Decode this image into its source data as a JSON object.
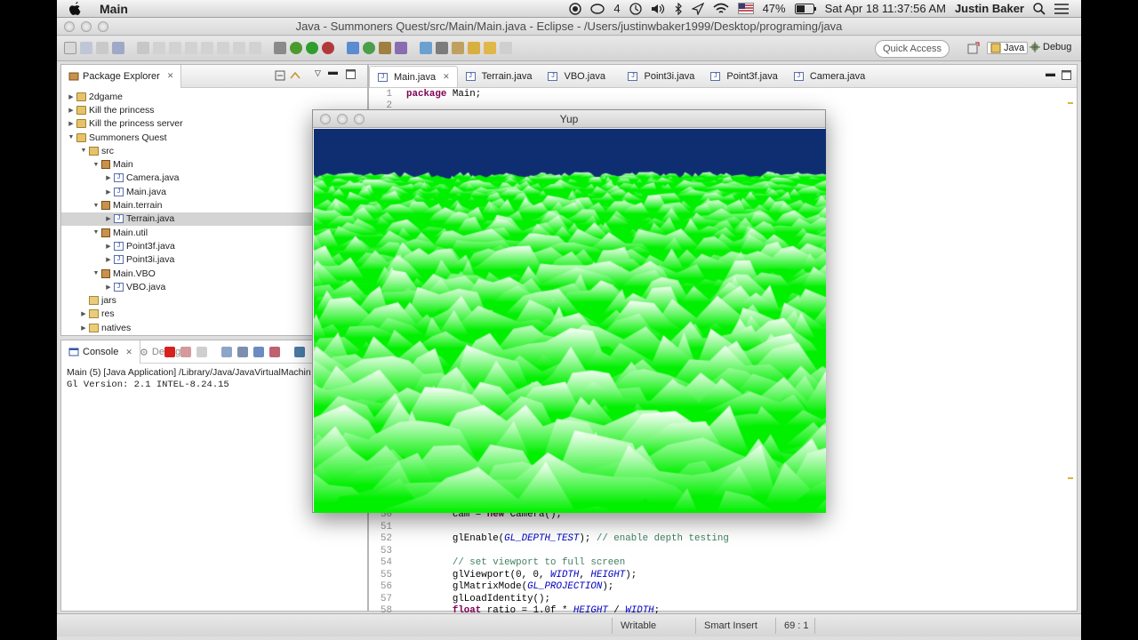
{
  "menubar": {
    "apple": "",
    "app": "Main",
    "wifi_count": "4",
    "battery": "47%",
    "datetime": "Sat Apr 18  11:37:56 AM",
    "user": "Justin Baker",
    "search_icon": "⌕",
    "list_icon": "☰"
  },
  "window_title": "Java - Summoners Quest/src/Main/Main.java - Eclipse - /Users/justinwbaker1999/Desktop/programing/java",
  "toolbar": {
    "quick_access": "Quick Access",
    "java_label": "Java",
    "debug_label": "Debug"
  },
  "package_explorer": {
    "title": "Package Explorer",
    "rows": [
      {
        "label": "2dgame",
        "arrow": "▶",
        "icon": "project",
        "indent": 0
      },
      {
        "label": "Kill the princess",
        "arrow": "▶",
        "icon": "project",
        "indent": 0
      },
      {
        "label": "Kill the princess server",
        "arrow": "▶",
        "icon": "project",
        "indent": 0
      },
      {
        "label": "Summoners Quest",
        "arrow": "▼",
        "icon": "project",
        "indent": 0
      },
      {
        "label": "src",
        "arrow": "▼",
        "icon": "src",
        "indent": 1
      },
      {
        "label": "Main",
        "arrow": "▼",
        "icon": "pkg",
        "indent": 2
      },
      {
        "label": "Camera.java",
        "arrow": "▶",
        "icon": "java",
        "indent": 3
      },
      {
        "label": "Main.java",
        "arrow": "▶",
        "icon": "java",
        "indent": 3
      },
      {
        "label": "Main.terrain",
        "arrow": "▼",
        "icon": "pkg",
        "indent": 2
      },
      {
        "label": "Terrain.java",
        "arrow": "▶",
        "icon": "java",
        "indent": 3,
        "selected": true
      },
      {
        "label": "Main.util",
        "arrow": "▼",
        "icon": "pkg",
        "indent": 2
      },
      {
        "label": "Point3f.java",
        "arrow": "▶",
        "icon": "java",
        "indent": 3
      },
      {
        "label": "Point3i.java",
        "arrow": "▶",
        "icon": "java",
        "indent": 3
      },
      {
        "label": "Main.VBO",
        "arrow": "▼",
        "icon": "pkg",
        "indent": 2
      },
      {
        "label": "VBO.java",
        "arrow": "▶",
        "icon": "java",
        "indent": 3
      },
      {
        "label": "jars",
        "arrow": "",
        "icon": "folder",
        "indent": 1
      },
      {
        "label": "res",
        "arrow": "▶",
        "icon": "folder",
        "indent": 1
      },
      {
        "label": "natives",
        "arrow": "▶",
        "icon": "folder",
        "indent": 1
      }
    ]
  },
  "console": {
    "tab_label": "Console",
    "debug_tab": "Debug",
    "description": "Main (5) [Java Application] /Library/Java/JavaVirtualMachin",
    "output": "Gl Version: 2.1 INTEL-8.24.15"
  },
  "editor": {
    "tabs": [
      "Main.java",
      "Terrain.java",
      "VBO.java",
      "Point3i.java",
      "Point3f.java",
      "Camera.java"
    ],
    "active_tab": "Main.java",
    "lines": [
      {
        "n": "1",
        "parts": [
          {
            "t": "package",
            "c": "kw"
          },
          {
            "t": " Main;",
            "c": "plain"
          }
        ]
      },
      {
        "n": "2",
        "parts": []
      },
      {
        "n": "50",
        "parts": [
          {
            "t": "        cam = ",
            "c": "plain"
          },
          {
            "t": "new",
            "c": "kw"
          },
          {
            "t": " Camera();",
            "c": "plain"
          }
        ]
      },
      {
        "n": "51",
        "parts": []
      },
      {
        "n": "52",
        "parts": [
          {
            "t": "        glEnable(",
            "c": "plain"
          },
          {
            "t": "GL_DEPTH_TEST",
            "c": "field"
          },
          {
            "t": "); ",
            "c": "plain"
          },
          {
            "t": "// enable depth testing",
            "c": "comment"
          }
        ]
      },
      {
        "n": "53",
        "parts": []
      },
      {
        "n": "54",
        "parts": [
          {
            "t": "        ",
            "c": "plain"
          },
          {
            "t": "// set viewport to full screen",
            "c": "comment"
          }
        ]
      },
      {
        "n": "55",
        "parts": [
          {
            "t": "        glViewport(0, 0, ",
            "c": "plain"
          },
          {
            "t": "WIDTH",
            "c": "field"
          },
          {
            "t": ", ",
            "c": "plain"
          },
          {
            "t": "HEIGHT",
            "c": "field"
          },
          {
            "t": ");",
            "c": "plain"
          }
        ]
      },
      {
        "n": "56",
        "parts": [
          {
            "t": "        glMatrixMode(",
            "c": "plain"
          },
          {
            "t": "GL_PROJECTION",
            "c": "field"
          },
          {
            "t": ");",
            "c": "plain"
          }
        ]
      },
      {
        "n": "57",
        "parts": [
          {
            "t": "        glLoadIdentity();",
            "c": "plain"
          }
        ]
      },
      {
        "n": "58",
        "parts": [
          {
            "t": "        ",
            "c": "plain"
          },
          {
            "t": "float",
            "c": "kw"
          },
          {
            "t": " ratio = 1.0f * ",
            "c": "plain"
          },
          {
            "t": "HEIGHT",
            "c": "field"
          },
          {
            "t": " / ",
            "c": "plain"
          },
          {
            "t": "WIDTH",
            "c": "field"
          },
          {
            "t": ";",
            "c": "plain"
          }
        ]
      }
    ]
  },
  "statusbar": {
    "writable": "Writable",
    "insert_mode": "Smart Insert",
    "position": "69 : 1"
  },
  "yup_window": {
    "title": "Yup",
    "sky_color": "#0f2e72",
    "terrain_colors": [
      "#00f000",
      "#ffffff",
      "#1010e0"
    ]
  }
}
